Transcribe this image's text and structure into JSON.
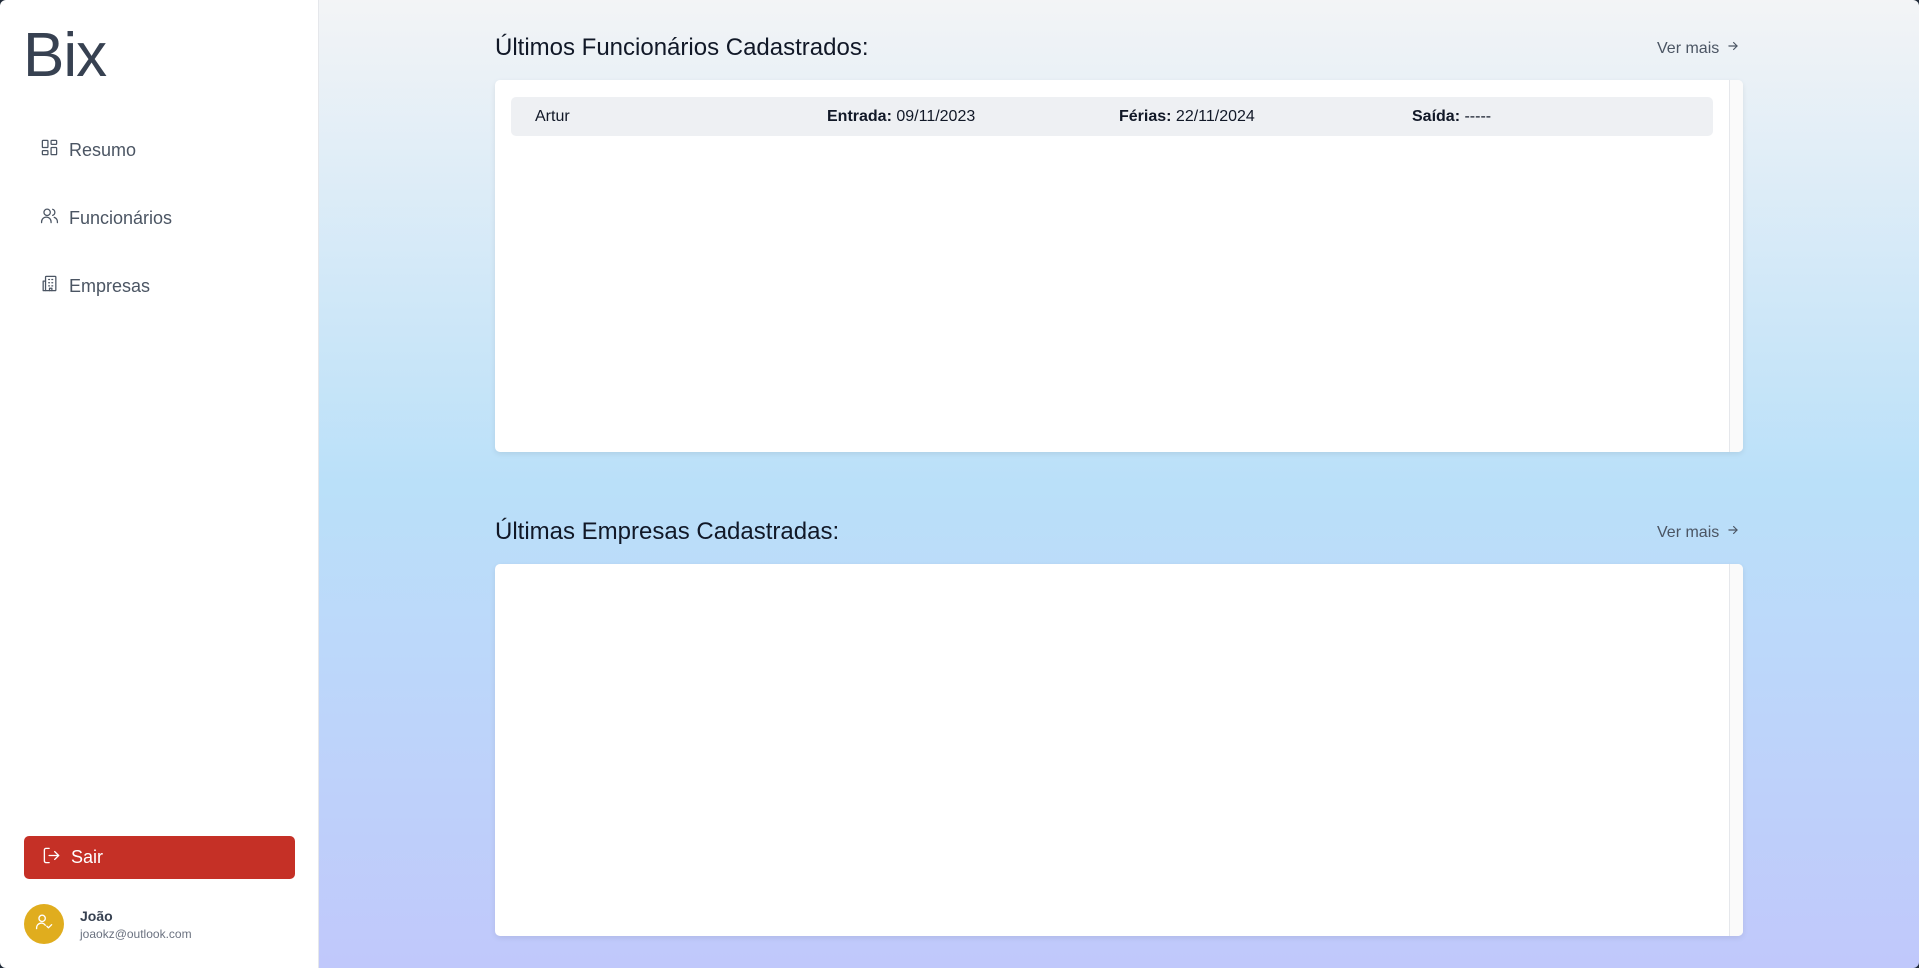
{
  "sidebar": {
    "logo": "Bix",
    "items": [
      {
        "label": "Resumo",
        "icon": "dashboard-icon"
      },
      {
        "label": "Funcionários",
        "icon": "users-icon"
      },
      {
        "label": "Empresas",
        "icon": "building-icon"
      }
    ],
    "logout_label": "Sair",
    "user": {
      "name": "João",
      "email": "joaokz@outlook.com"
    }
  },
  "employees": {
    "title": "Últimos Funcionários Cadastrados:",
    "more_label": "Ver mais",
    "labels": {
      "entrada": "Entrada:",
      "ferias": "Férias:",
      "saida": "Saída:"
    },
    "rows": [
      {
        "name": "Artur",
        "entrada": "09/11/2023",
        "ferias": "22/11/2024",
        "saida": "-----"
      }
    ]
  },
  "companies": {
    "title": "Últimas Empresas Cadastradas:",
    "more_label": "Ver mais",
    "rows": []
  },
  "colors": {
    "logout": "#c53026",
    "avatar": "#e0ad1e"
  }
}
